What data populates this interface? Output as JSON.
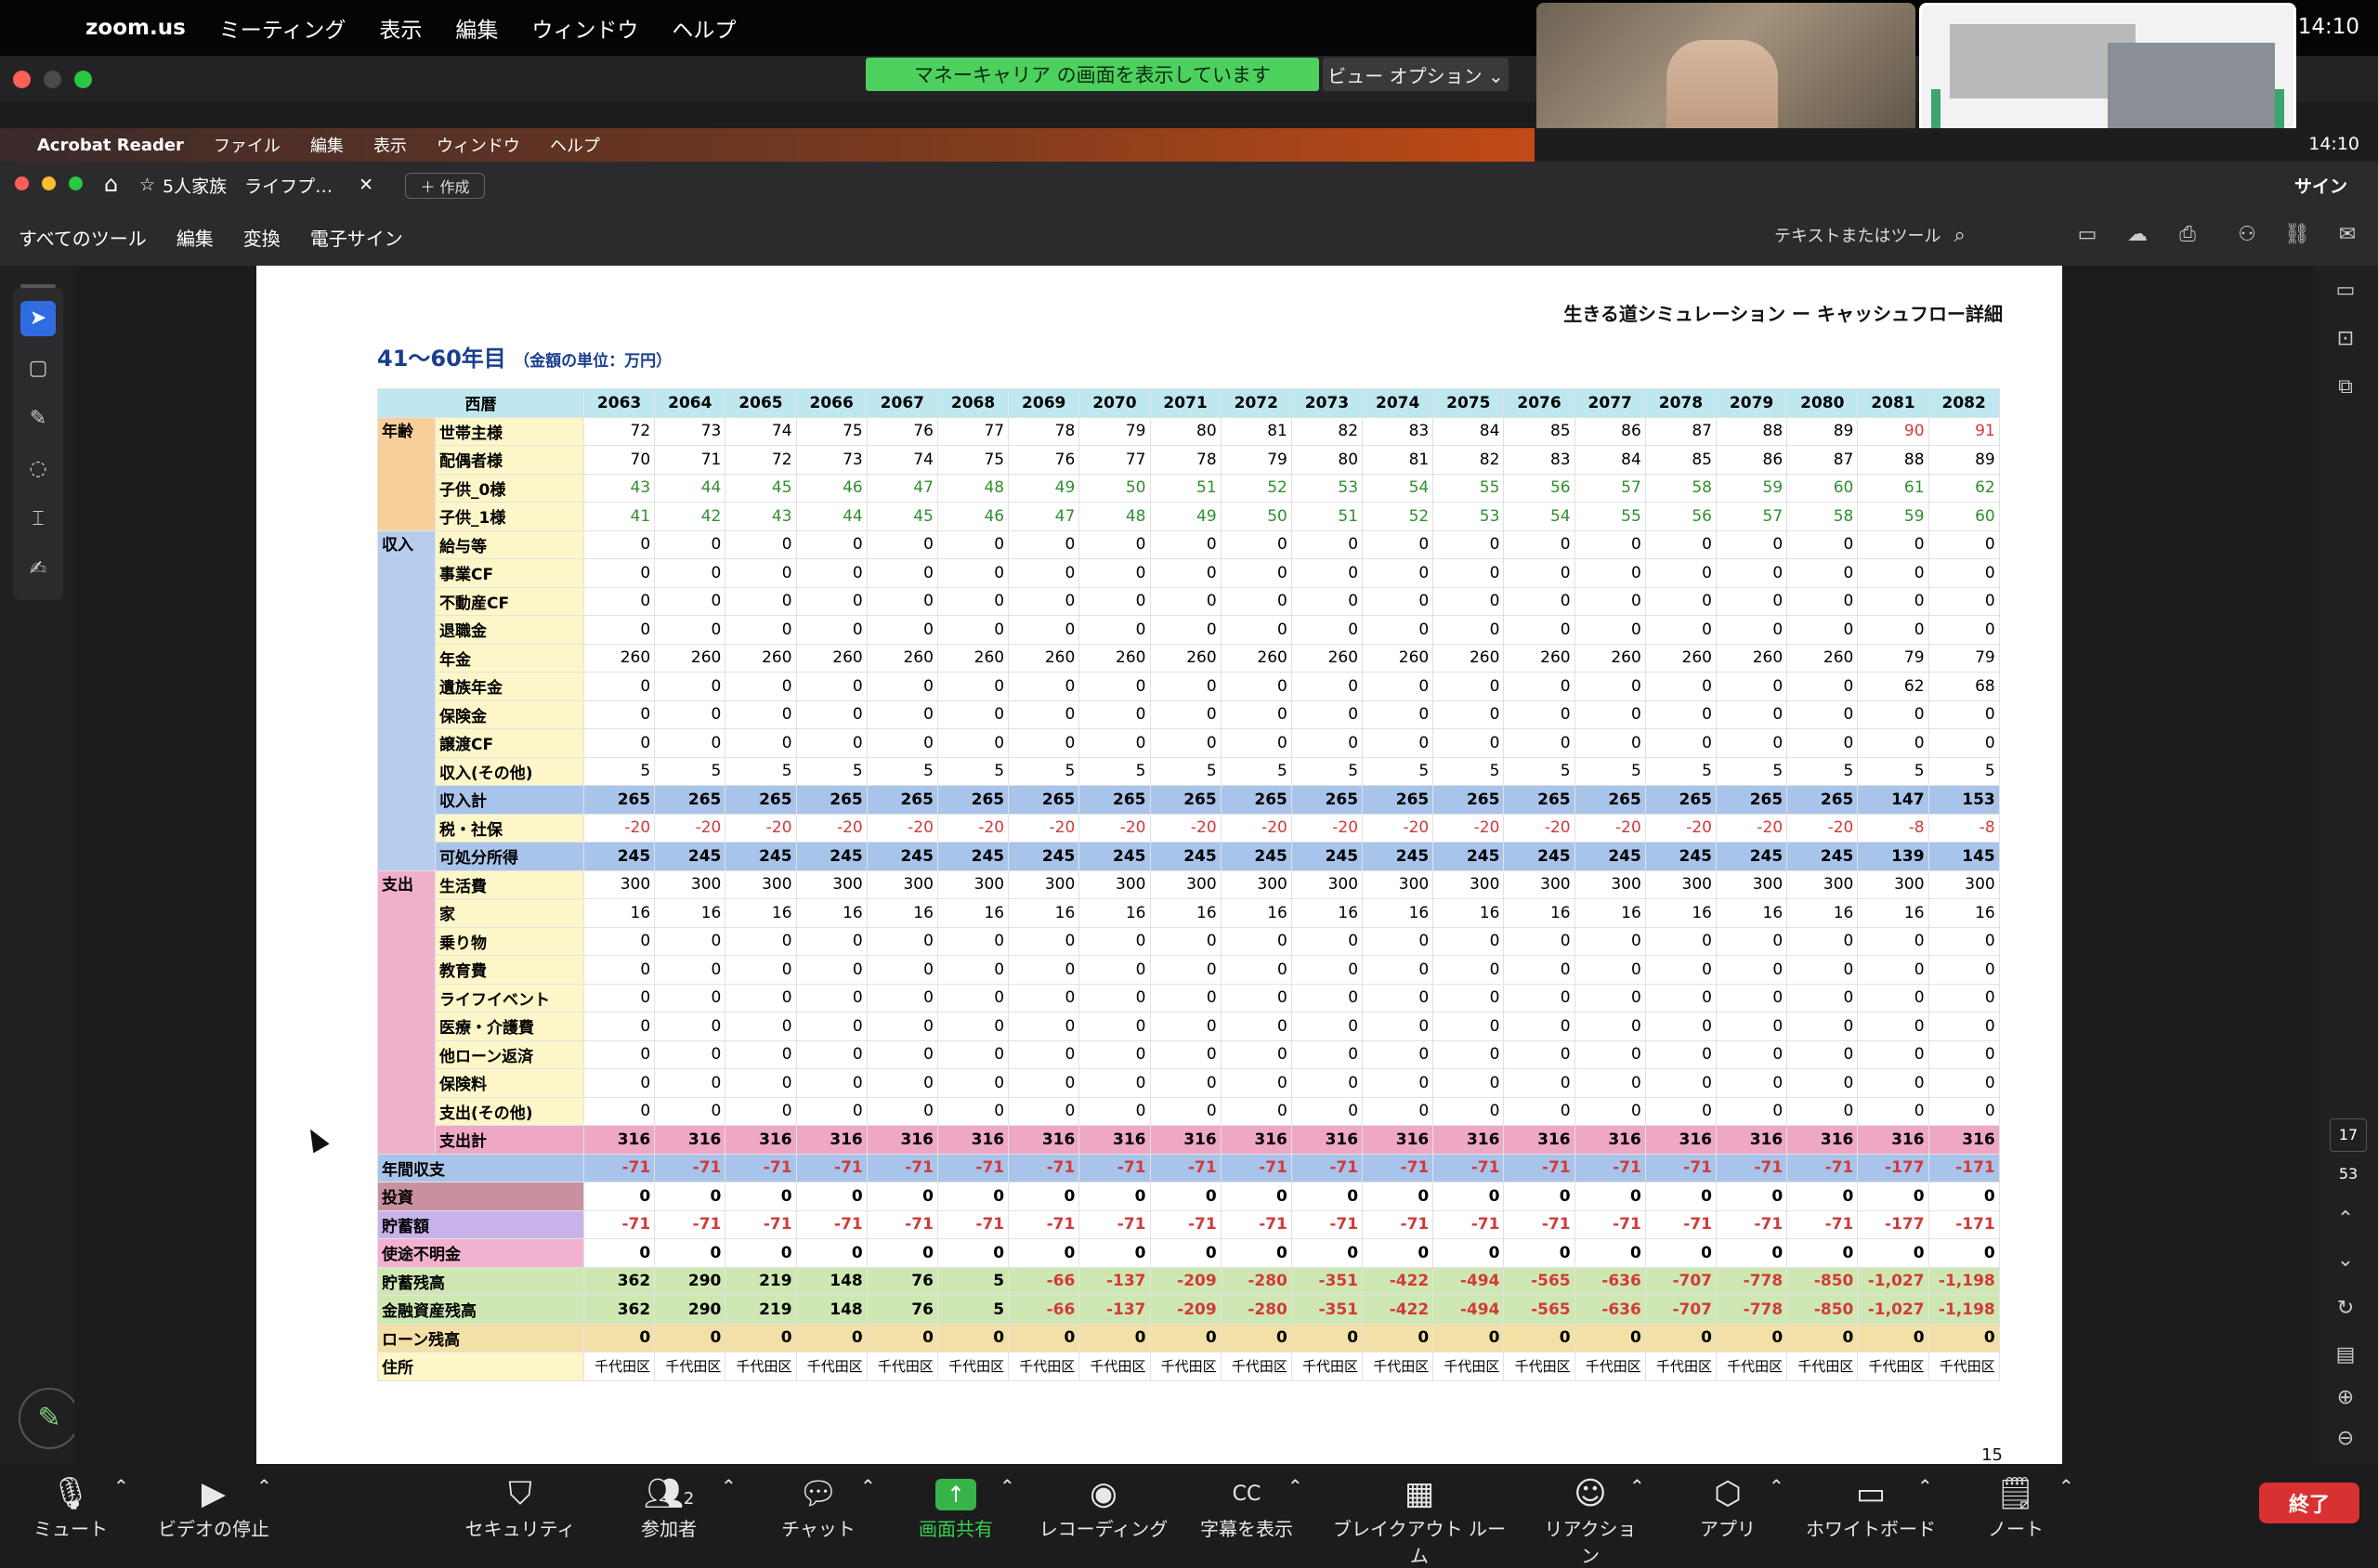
{
  "menubar": {
    "app": "zoom.us",
    "items": [
      "ミーティング",
      "表示",
      "編集",
      "ウィンドウ",
      "ヘルプ"
    ],
    "clock": "14:10"
  },
  "zoom": {
    "share_banner": "マネーキャリア の画面を表示しています",
    "view_options": "ビュー オプション ⌄"
  },
  "acrobat": {
    "menu": [
      "Acrobat Reader",
      "ファイル",
      "編集",
      "表示",
      "ウィンドウ",
      "ヘルプ"
    ],
    "clock": "14:10",
    "tab_title": "5人家族　ライフプ…",
    "new_tab": "作成",
    "toolbar": [
      "すべてのツール",
      "編集",
      "変換",
      "電子サイン"
    ],
    "search_placeholder": "テキストまたはツール",
    "sign_label": "サイン",
    "page_current": "17",
    "page_total": "53"
  },
  "doc": {
    "title_right": "生きる道シミュレーション ー キャッシュフロー詳細",
    "range_title": "41〜60年目",
    "unit_note": "（金額の単位：万円）",
    "page_footer": "15",
    "header_label": "西暦",
    "years": [
      2063,
      2064,
      2065,
      2066,
      2067,
      2068,
      2069,
      2070,
      2071,
      2072,
      2073,
      2074,
      2075,
      2076,
      2077,
      2078,
      2079,
      2080,
      2081,
      2082
    ],
    "categories": {
      "age": "年齢",
      "income": "収入",
      "expense": "支出"
    },
    "age_rows": [
      {
        "label": "世帯主様",
        "values": [
          "72",
          "73",
          "74",
          "75",
          "76",
          "77",
          "78",
          "79",
          "80",
          "81",
          "82",
          "83",
          "84",
          "85",
          "86",
          "87",
          "88",
          "89",
          "90",
          "91"
        ]
      },
      {
        "label": "配偶者様",
        "values": [
          "70",
          "71",
          "72",
          "73",
          "74",
          "75",
          "76",
          "77",
          "78",
          "79",
          "80",
          "81",
          "82",
          "83",
          "84",
          "85",
          "86",
          "87",
          "88",
          "89"
        ]
      },
      {
        "label": "子供_0様",
        "values": [
          "43",
          "44",
          "45",
          "46",
          "47",
          "48",
          "49",
          "50",
          "51",
          "52",
          "53",
          "54",
          "55",
          "56",
          "57",
          "58",
          "59",
          "60",
          "61",
          "62"
        ]
      },
      {
        "label": "子供_1様",
        "values": [
          "41",
          "42",
          "43",
          "44",
          "45",
          "46",
          "47",
          "48",
          "49",
          "50",
          "51",
          "52",
          "53",
          "54",
          "55",
          "56",
          "57",
          "58",
          "59",
          "60"
        ]
      }
    ],
    "income_rows": [
      {
        "label": "給与等",
        "values": [
          "0",
          "0",
          "0",
          "0",
          "0",
          "0",
          "0",
          "0",
          "0",
          "0",
          "0",
          "0",
          "0",
          "0",
          "0",
          "0",
          "0",
          "0",
          "0",
          "0"
        ]
      },
      {
        "label": "事業CF",
        "values": [
          "0",
          "0",
          "0",
          "0",
          "0",
          "0",
          "0",
          "0",
          "0",
          "0",
          "0",
          "0",
          "0",
          "0",
          "0",
          "0",
          "0",
          "0",
          "0",
          "0"
        ]
      },
      {
        "label": "不動産CF",
        "values": [
          "0",
          "0",
          "0",
          "0",
          "0",
          "0",
          "0",
          "0",
          "0",
          "0",
          "0",
          "0",
          "0",
          "0",
          "0",
          "0",
          "0",
          "0",
          "0",
          "0"
        ]
      },
      {
        "label": "退職金",
        "values": [
          "0",
          "0",
          "0",
          "0",
          "0",
          "0",
          "0",
          "0",
          "0",
          "0",
          "0",
          "0",
          "0",
          "0",
          "0",
          "0",
          "0",
          "0",
          "0",
          "0"
        ]
      },
      {
        "label": "年金",
        "values": [
          "260",
          "260",
          "260",
          "260",
          "260",
          "260",
          "260",
          "260",
          "260",
          "260",
          "260",
          "260",
          "260",
          "260",
          "260",
          "260",
          "260",
          "260",
          "79",
          "79"
        ]
      },
      {
        "label": "遺族年金",
        "values": [
          "0",
          "0",
          "0",
          "0",
          "0",
          "0",
          "0",
          "0",
          "0",
          "0",
          "0",
          "0",
          "0",
          "0",
          "0",
          "0",
          "0",
          "0",
          "62",
          "68"
        ]
      },
      {
        "label": "保険金",
        "values": [
          "0",
          "0",
          "0",
          "0",
          "0",
          "0",
          "0",
          "0",
          "0",
          "0",
          "0",
          "0",
          "0",
          "0",
          "0",
          "0",
          "0",
          "0",
          "0",
          "0"
        ]
      },
      {
        "label": "譲渡CF",
        "values": [
          "0",
          "0",
          "0",
          "0",
          "0",
          "0",
          "0",
          "0",
          "0",
          "0",
          "0",
          "0",
          "0",
          "0",
          "0",
          "0",
          "0",
          "0",
          "0",
          "0"
        ]
      },
      {
        "label": "収入(その他)",
        "values": [
          "5",
          "5",
          "5",
          "5",
          "5",
          "5",
          "5",
          "5",
          "5",
          "5",
          "5",
          "5",
          "5",
          "5",
          "5",
          "5",
          "5",
          "5",
          "5",
          "5"
        ]
      }
    ],
    "income_total": {
      "label": "収入計",
      "values": [
        "265",
        "265",
        "265",
        "265",
        "265",
        "265",
        "265",
        "265",
        "265",
        "265",
        "265",
        "265",
        "265",
        "265",
        "265",
        "265",
        "265",
        "265",
        "147",
        "153"
      ]
    },
    "tax": {
      "label": "税・社保",
      "values": [
        "-20",
        "-20",
        "-20",
        "-20",
        "-20",
        "-20",
        "-20",
        "-20",
        "-20",
        "-20",
        "-20",
        "-20",
        "-20",
        "-20",
        "-20",
        "-20",
        "-20",
        "-20",
        "-8",
        "-8"
      ]
    },
    "disposable": {
      "label": "可処分所得",
      "values": [
        "245",
        "245",
        "245",
        "245",
        "245",
        "245",
        "245",
        "245",
        "245",
        "245",
        "245",
        "245",
        "245",
        "245",
        "245",
        "245",
        "245",
        "245",
        "139",
        "145"
      ]
    },
    "expense_rows": [
      {
        "label": "生活費",
        "values": [
          "300",
          "300",
          "300",
          "300",
          "300",
          "300",
          "300",
          "300",
          "300",
          "300",
          "300",
          "300",
          "300",
          "300",
          "300",
          "300",
          "300",
          "300",
          "300",
          "300"
        ]
      },
      {
        "label": "家",
        "values": [
          "16",
          "16",
          "16",
          "16",
          "16",
          "16",
          "16",
          "16",
          "16",
          "16",
          "16",
          "16",
          "16",
          "16",
          "16",
          "16",
          "16",
          "16",
          "16",
          "16"
        ]
      },
      {
        "label": "乗り物",
        "values": [
          "0",
          "0",
          "0",
          "0",
          "0",
          "0",
          "0",
          "0",
          "0",
          "0",
          "0",
          "0",
          "0",
          "0",
          "0",
          "0",
          "0",
          "0",
          "0",
          "0"
        ]
      },
      {
        "label": "教育費",
        "values": [
          "0",
          "0",
          "0",
          "0",
          "0",
          "0",
          "0",
          "0",
          "0",
          "0",
          "0",
          "0",
          "0",
          "0",
          "0",
          "0",
          "0",
          "0",
          "0",
          "0"
        ]
      },
      {
        "label": "ライフイベント",
        "values": [
          "0",
          "0",
          "0",
          "0",
          "0",
          "0",
          "0",
          "0",
          "0",
          "0",
          "0",
          "0",
          "0",
          "0",
          "0",
          "0",
          "0",
          "0",
          "0",
          "0"
        ]
      },
      {
        "label": "医療・介護費",
        "values": [
          "0",
          "0",
          "0",
          "0",
          "0",
          "0",
          "0",
          "0",
          "0",
          "0",
          "0",
          "0",
          "0",
          "0",
          "0",
          "0",
          "0",
          "0",
          "0",
          "0"
        ]
      },
      {
        "label": "他ローン返済",
        "values": [
          "0",
          "0",
          "0",
          "0",
          "0",
          "0",
          "0",
          "0",
          "0",
          "0",
          "0",
          "0",
          "0",
          "0",
          "0",
          "0",
          "0",
          "0",
          "0",
          "0"
        ]
      },
      {
        "label": "保険料",
        "values": [
          "0",
          "0",
          "0",
          "0",
          "0",
          "0",
          "0",
          "0",
          "0",
          "0",
          "0",
          "0",
          "0",
          "0",
          "0",
          "0",
          "0",
          "0",
          "0",
          "0"
        ]
      },
      {
        "label": "支出(その他)",
        "values": [
          "0",
          "0",
          "0",
          "0",
          "0",
          "0",
          "0",
          "0",
          "0",
          "0",
          "0",
          "0",
          "0",
          "0",
          "0",
          "0",
          "0",
          "0",
          "0",
          "0"
        ]
      }
    ],
    "expense_total": {
      "label": "支出計",
      "values": [
        "316",
        "316",
        "316",
        "316",
        "316",
        "316",
        "316",
        "316",
        "316",
        "316",
        "316",
        "316",
        "316",
        "316",
        "316",
        "316",
        "316",
        "316",
        "316",
        "316"
      ]
    },
    "annual_balance": {
      "label": "年間収支",
      "values": [
        "-71",
        "-71",
        "-71",
        "-71",
        "-71",
        "-71",
        "-71",
        "-71",
        "-71",
        "-71",
        "-71",
        "-71",
        "-71",
        "-71",
        "-71",
        "-71",
        "-71",
        "-71",
        "-177",
        "-171"
      ]
    },
    "investment": {
      "label": "投資",
      "values": [
        "0",
        "0",
        "0",
        "0",
        "0",
        "0",
        "0",
        "0",
        "0",
        "0",
        "0",
        "0",
        "0",
        "0",
        "0",
        "0",
        "0",
        "0",
        "0",
        "0"
      ]
    },
    "savings_amount": {
      "label": "貯蓄額",
      "values": [
        "-71",
        "-71",
        "-71",
        "-71",
        "-71",
        "-71",
        "-71",
        "-71",
        "-71",
        "-71",
        "-71",
        "-71",
        "-71",
        "-71",
        "-71",
        "-71",
        "-71",
        "-71",
        "-177",
        "-171"
      ]
    },
    "unknown": {
      "label": "使途不明金",
      "values": [
        "0",
        "0",
        "0",
        "0",
        "0",
        "0",
        "0",
        "0",
        "0",
        "0",
        "0",
        "0",
        "0",
        "0",
        "0",
        "0",
        "0",
        "0",
        "0",
        "0"
      ]
    },
    "savings_balance": {
      "label": "貯蓄残高",
      "values": [
        "362",
        "290",
        "219",
        "148",
        "76",
        "5",
        "-66",
        "-137",
        "-209",
        "-280",
        "-351",
        "-422",
        "-494",
        "-565",
        "-636",
        "-707",
        "-778",
        "-850",
        "-1,027",
        "-1,198"
      ]
    },
    "financial_assets": {
      "label": "金融資産残高",
      "values": [
        "362",
        "290",
        "219",
        "148",
        "76",
        "5",
        "-66",
        "-137",
        "-209",
        "-280",
        "-351",
        "-422",
        "-494",
        "-565",
        "-636",
        "-707",
        "-778",
        "-850",
        "-1,027",
        "-1,198"
      ]
    },
    "loan_balance": {
      "label": "ローン残高",
      "values": [
        "0",
        "0",
        "0",
        "0",
        "0",
        "0",
        "0",
        "0",
        "0",
        "0",
        "0",
        "0",
        "0",
        "0",
        "0",
        "0",
        "0",
        "0",
        "0",
        "0"
      ]
    },
    "address": {
      "label": "住所",
      "values": [
        "千代田区",
        "千代田区",
        "千代田区",
        "千代田区",
        "千代田区",
        "千代田区",
        "千代田区",
        "千代田区",
        "千代田区",
        "千代田区",
        "千代田区",
        "千代田区",
        "千代田区",
        "千代田区",
        "千代田区",
        "千代田区",
        "千代田区",
        "千代田区",
        "千代田区",
        "千代田区"
      ]
    }
  },
  "bottom_bar": {
    "mute": "ミュート",
    "video": "ビデオの停止",
    "security": "セキュリティ",
    "participants": "参加者",
    "participants_count": "2",
    "chat": "チャット",
    "share": "画面共有",
    "record": "レコーディング",
    "captions": "字幕を表示",
    "breakout": "ブレイクアウト ルーム",
    "reactions": "リアクション",
    "apps": "アプリ",
    "whiteboard": "ホワイトボード",
    "notes": "ノート",
    "end": "終了"
  },
  "colors": {
    "share_green": "#4cd05e",
    "end_red": "#d93131",
    "neg_red": "#d23a3a",
    "age_green": "#2f8f2f"
  }
}
